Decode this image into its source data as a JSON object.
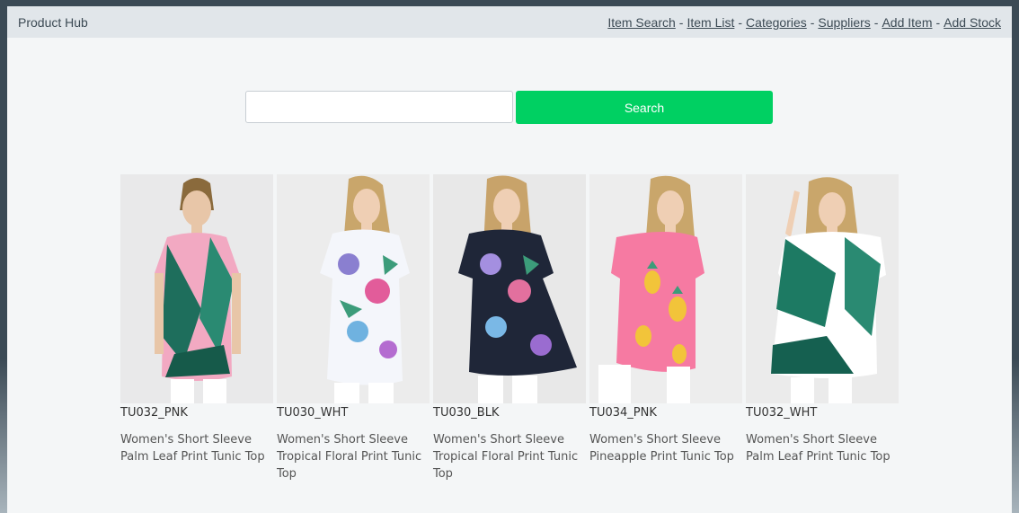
{
  "header": {
    "brand": "Product Hub",
    "links": [
      "Item Search",
      "Item List",
      "Categories",
      "Suppliers",
      "Add Item",
      "Add Stock"
    ],
    "separator": "-"
  },
  "search": {
    "value": "",
    "placeholder": "",
    "button_label": "Search"
  },
  "products": [
    {
      "sku": "TU032_PNK",
      "name": "Women's Short Sleeve Palm Leaf Print Tunic Top"
    },
    {
      "sku": "TU030_WHT",
      "name": "Women's Short Sleeve Tropical Floral Print Tunic Top"
    },
    {
      "sku": "TU030_BLK",
      "name": "Women's Short Sleeve Tropical Floral Print Tunic Top"
    },
    {
      "sku": "TU034_PNK",
      "name": "Women's Short Sleeve Pineapple Print Tunic Top"
    },
    {
      "sku": "TU032_WHT",
      "name": "Women's Short Sleeve Palm Leaf Print Tunic Top"
    }
  ],
  "colors": {
    "accent": "#00d062",
    "navbar": "#e1e6ea",
    "page": "#f4f6f7"
  }
}
